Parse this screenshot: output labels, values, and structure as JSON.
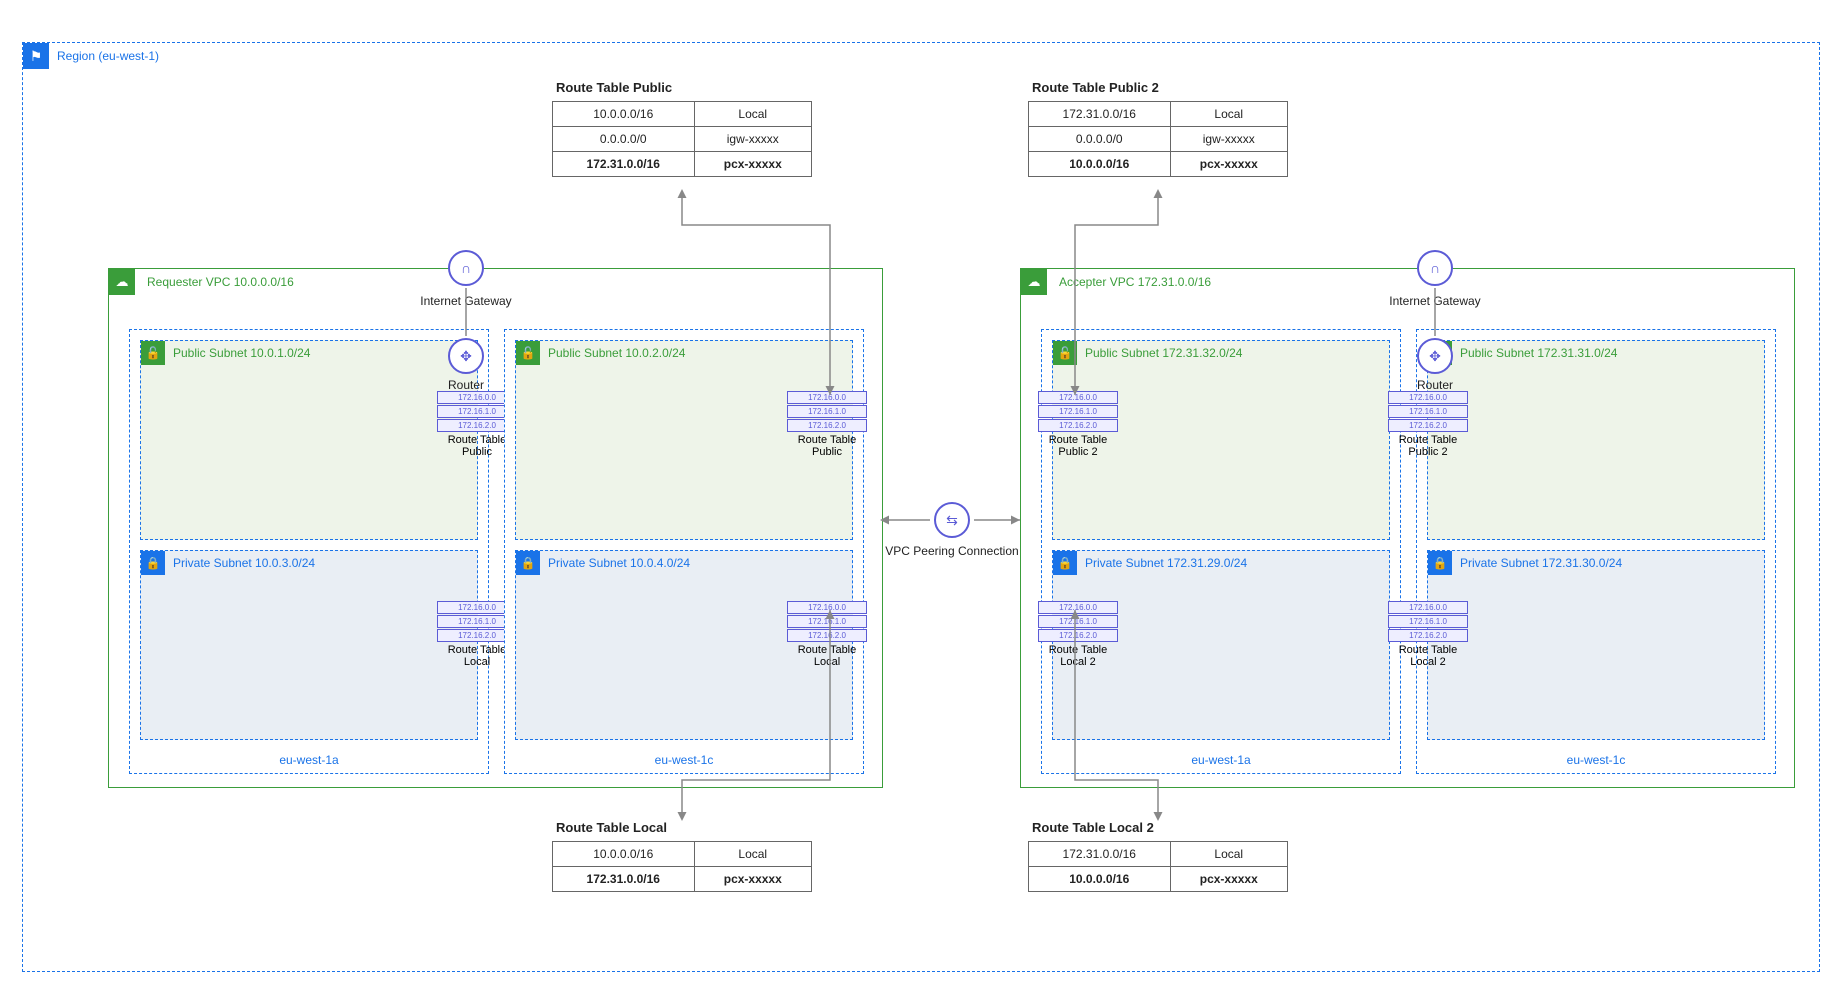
{
  "region": {
    "label": "Region (eu-west-1)"
  },
  "route_tables": {
    "public_left": {
      "title": "Route Table Public",
      "rows": [
        {
          "dest": "10.0.0.0/16",
          "target": "Local"
        },
        {
          "dest": "0.0.0.0/0",
          "target": "igw-xxxxx"
        },
        {
          "dest": "172.31.0.0/16",
          "target": "pcx-xxxxx",
          "bold": true
        }
      ]
    },
    "public_right": {
      "title": "Route Table Public 2",
      "rows": [
        {
          "dest": "172.31.0.0/16",
          "target": "Local"
        },
        {
          "dest": "0.0.0.0/0",
          "target": "igw-xxxxx"
        },
        {
          "dest": "10.0.0.0/16",
          "target": "pcx-xxxxx",
          "bold": true
        }
      ]
    },
    "local_left": {
      "title": "Route Table Local",
      "rows": [
        {
          "dest": "10.0.0.0/16",
          "target": "Local"
        },
        {
          "dest": "172.31.0.0/16",
          "target": "pcx-xxxxx",
          "bold": true
        }
      ]
    },
    "local_right": {
      "title": "Route Table Local 2",
      "rows": [
        {
          "dest": "172.31.0.0/16",
          "target": "Local"
        },
        {
          "dest": "10.0.0.0/16",
          "target": "pcx-xxxxx",
          "bold": true
        }
      ]
    }
  },
  "vpcs": {
    "left": {
      "label": "Requester VPC 10.0.0.0/16",
      "igw_label": "Internet Gateway",
      "router_label": "Router",
      "azs": [
        {
          "az_label": "eu-west-1a",
          "public_subnet": "Public Subnet 10.0.1.0/24",
          "private_subnet": "Private Subnet 10.0.3.0/24",
          "rt_public_label": "Route Table Public",
          "rt_local_label": "Route Table Local"
        },
        {
          "az_label": "eu-west-1c",
          "public_subnet": "Public Subnet 10.0.2.0/24",
          "private_subnet": "Private Subnet 10.0.4.0/24",
          "rt_public_label": "Route Table Public",
          "rt_local_label": "Route Table Local"
        }
      ]
    },
    "right": {
      "label": "Accepter VPC 172.31.0.0/16",
      "igw_label": "Internet Gateway",
      "router_label": "Router",
      "azs": [
        {
          "az_label": "eu-west-1a",
          "public_subnet": "Public Subnet 172.31.32.0/24",
          "private_subnet": "Private Subnet 172.31.29.0/24",
          "rt_public_label": "Route Table Public 2",
          "rt_local_label": "Route Table Local 2"
        },
        {
          "az_label": "eu-west-1c",
          "public_subnet": "Public Subnet 172.31.31.0/24",
          "private_subnet": "Private Subnet 172.31.30.0/24",
          "rt_public_label": "Route Table Public 2",
          "rt_local_label": "Route Table Local 2"
        }
      ]
    }
  },
  "rt_mini_rows": [
    "172.16.0.0",
    "172.16.1.0",
    "172.16.2.0"
  ],
  "peering": {
    "label": "VPC Peering Connection"
  }
}
